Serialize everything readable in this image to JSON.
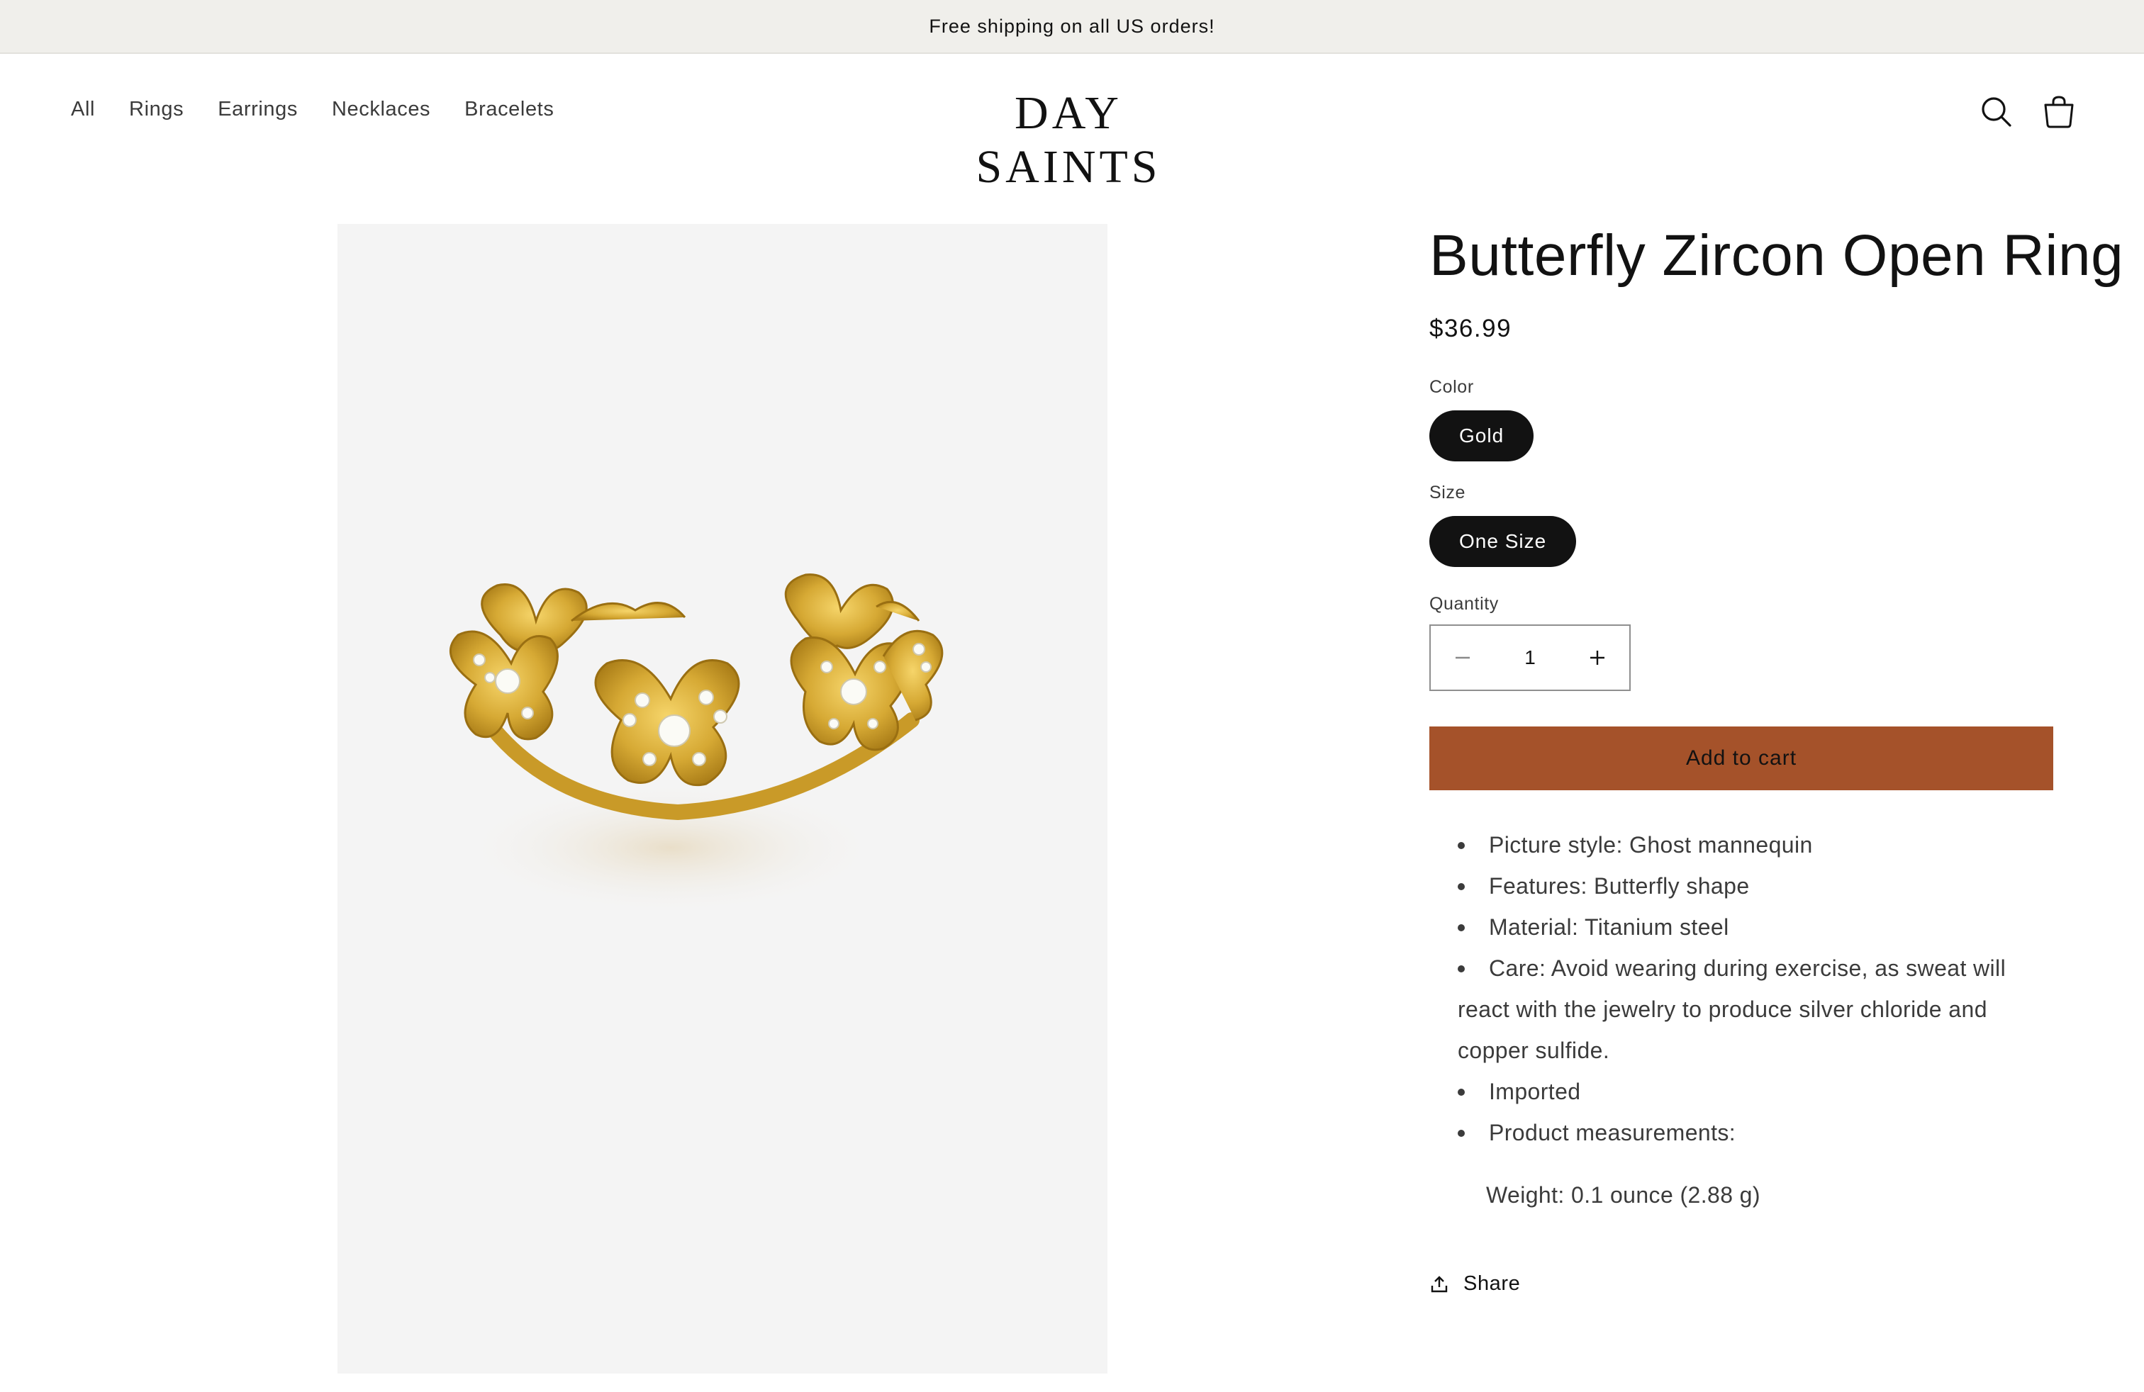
{
  "announcement": {
    "text": "Free shipping on all US orders!"
  },
  "header": {
    "nav": [
      "All",
      "Rings",
      "Earrings",
      "Necklaces",
      "Bracelets"
    ],
    "logo": "DAY SAINTS",
    "icons": {
      "search": "search-icon",
      "cart": "cart-icon"
    }
  },
  "product": {
    "title": "Butterfly Zircon Open Ring",
    "price": "$36.99",
    "color_label": "Color",
    "color_value": "Gold",
    "size_label": "Size",
    "size_value": "One Size",
    "quantity_label": "Quantity",
    "quantity_value": "1",
    "add_to_cart": "Add to cart",
    "description": [
      "Picture style: Ghost mannequin",
      "Features: Butterfly shape",
      "Material: Titanium steel",
      "Care: Avoid wearing during exercise, as sweat will react with the jewelry to produce silver chloride and copper sulfide.",
      "Imported",
      "Product measurements:"
    ],
    "weight": "Weight: 0.1 ounce (2.88 g)",
    "share": "Share"
  },
  "colors": {
    "accent": "#a5522a",
    "pill": "#121212",
    "announcement_bg": "#f0efeb",
    "image_bg": "#f4f4f4",
    "gold": "#d4a935"
  }
}
